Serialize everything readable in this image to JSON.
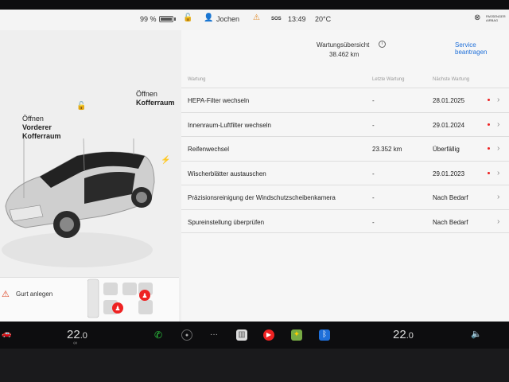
{
  "status": {
    "battery_percent": "99 %",
    "user": "Jochen",
    "sos": "SOS",
    "time": "13:49",
    "outside_temp": "20°C",
    "airbag_line1": "PASSENGER",
    "airbag_line2": "AIRBAG"
  },
  "car": {
    "frunk_line1": "Öffnen",
    "frunk_line2": "Vorderer",
    "frunk_line3": "Kofferraum",
    "trunk_line1": "Öffnen",
    "trunk_line2": "Kofferraum"
  },
  "seatbelt": {
    "label": "Gurt anlegen"
  },
  "service": {
    "title": "Wartungsübersicht",
    "odometer": "38.462 km",
    "request_link": "Service beantragen",
    "col_task": "Wartung",
    "col_last": "Letzte Wartung",
    "col_next": "Nächste Wartung",
    "rows": [
      {
        "task": "HEPA-Filter wechseln",
        "last": "-",
        "next": "28.01.2025",
        "dot": true
      },
      {
        "task": "Innenraum-Luftfilter wechseln",
        "last": "-",
        "next": "29.01.2024",
        "dot": true
      },
      {
        "task": "Reifenwechsel",
        "last": "23.352 km",
        "next": "Überfällig",
        "dot": true
      },
      {
        "task": "Wischerblätter austauschen",
        "last": "-",
        "next": "29.01.2023",
        "dot": true
      },
      {
        "task": "Präzisionsreinigung der Windschutzscheibenkamera",
        "last": "-",
        "next": "Nach Bedarf",
        "dot": false
      },
      {
        "task": "Spureinstellung überprüfen",
        "last": "-",
        "next": "Nach Bedarf",
        "dot": false
      }
    ]
  },
  "climate": {
    "left_temp": "22",
    "left_decimal": ".0",
    "right_temp": "22",
    "right_decimal": ".0"
  },
  "colors": {
    "accent_blue": "#1e6fd9",
    "alert_red": "#e22222"
  }
}
